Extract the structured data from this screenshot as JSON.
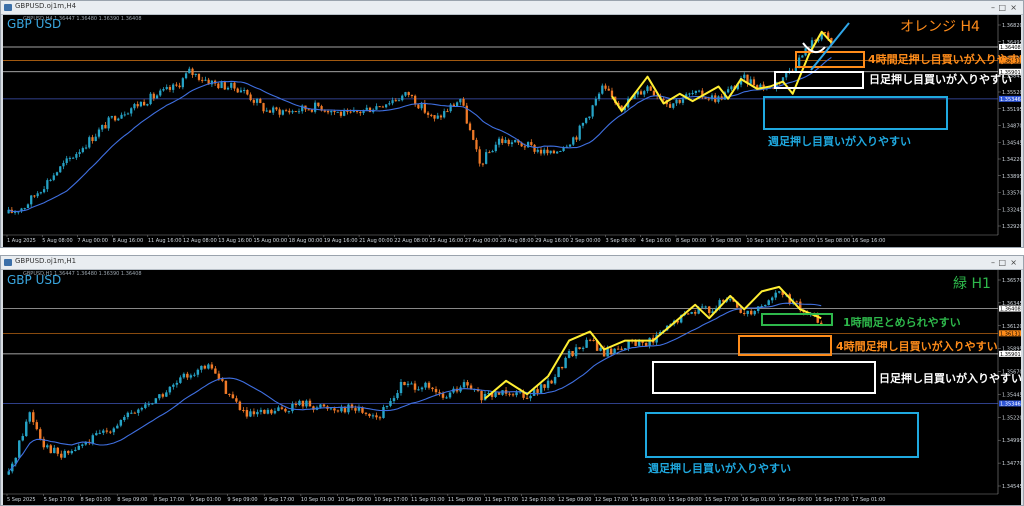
{
  "colors": {
    "bg": "#000000",
    "up": "#26a3c6",
    "down": "#f07a28",
    "ma": "#3f6fe0",
    "zigzag": "#ffee33",
    "orange": "#ff8c1a",
    "white": "#ffffff",
    "blue": "#1fa9e0",
    "green": "#2eb84b",
    "curve": "#ffffff",
    "curve_blue": "#2fa6e8"
  },
  "window_top": {
    "title": "GBPUSD.oj1m,H4",
    "ohlc": "GBPUSD,H4  1.36447 1.36480 1.36390 1.36408",
    "symbol": "GBP USD",
    "timeframe_label": "オレンジ H4",
    "price_ticks": [
      "1.36820",
      "1.36495",
      "1.36170",
      "1.35845",
      "1.35520",
      "1.35195",
      "1.34870",
      "1.34545",
      "1.34220",
      "1.33895",
      "1.33570",
      "1.33245",
      "1.32920"
    ],
    "date_ticks": [
      "1 Aug 2025",
      "5 Aug 08:00",
      "7 Aug 00:00",
      "8 Aug 16:00",
      "11 Aug 16:00",
      "12 Aug 08:00",
      "13 Aug 16:00",
      "15 Aug 00:00",
      "18 Aug 00:00",
      "19 Aug 16:00",
      "21 Aug 00:00",
      "22 Aug 08:00",
      "25 Aug 16:00",
      "27 Aug 00:00",
      "28 Aug 08:00",
      "29 Aug 16:00",
      "2 Sep 00:00",
      "3 Sep 08:00",
      "4 Sep 16:00",
      "8 Sep 00:00",
      "9 Sep 08:00",
      "10 Sep 16:00",
      "12 Sep 00:00",
      "15 Sep 08:00",
      "16 Sep 16:00"
    ],
    "level_labels": [
      "1.36408",
      "1.36131",
      "1.35901",
      "1.35346"
    ],
    "annotations": {
      "h4": "4時間足押し目買いが入りやすい",
      "daily": "日足押し目買いが入りやすい",
      "weekly": "週足押し目買いが入りやすい"
    }
  },
  "window_bottom": {
    "title": "GBPUSD.oj1m,H1",
    "ohlc": "GBPUSD,H1  1.36447 1.36480 1.36390 1.36408",
    "symbol": "GBP USD",
    "timeframe_label": "緑 H1",
    "price_ticks": [
      "1.36570",
      "1.36345",
      "1.36120",
      "1.35895",
      "1.35670",
      "1.35445",
      "1.35220",
      "1.34995",
      "1.34770",
      "1.34545"
    ],
    "date_ticks": [
      "5 Sep 2025",
      "5 Sep 17:00",
      "8 Sep 01:00",
      "8 Sep 09:00",
      "8 Sep 17:00",
      "9 Sep 01:00",
      "9 Sep 09:00",
      "9 Sep 17:00",
      "10 Sep 01:00",
      "10 Sep 09:00",
      "10 Sep 17:00",
      "11 Sep 01:00",
      "11 Sep 09:00",
      "11 Sep 17:00",
      "12 Sep 01:00",
      "12 Sep 09:00",
      "12 Sep 17:00",
      "15 Sep 01:00",
      "15 Sep 09:00",
      "15 Sep 17:00",
      "16 Sep 01:00",
      "16 Sep 09:00",
      "16 Sep 17:00",
      "17 Sep 01:00"
    ],
    "level_labels": [
      "1.36408",
      "1.36131",
      "1.35901",
      "1.35346"
    ],
    "annotations": {
      "h1": "1時間足とめられやすい",
      "h4": "4時間足押し目買いが入りやすい",
      "daily": "日足押し目買いが入りやすい",
      "weekly": "週足押し目買いが入りやすい"
    }
  },
  "chart_data": [
    {
      "type": "candlestick",
      "title": "GBPUSD.oj1m,H4",
      "ylim": [
        1.327,
        1.369
      ],
      "levels": [
        1.36408,
        1.36131,
        1.35901,
        1.35346
      ],
      "x_range": [
        "1 Aug 2025",
        "17 Sep 2025"
      ],
      "anchors": [
        [
          0,
          1.33
        ],
        [
          5,
          1.3315
        ],
        [
          14,
          1.338
        ],
        [
          25,
          1.345
        ],
        [
          33,
          1.35
        ],
        [
          42,
          1.353
        ],
        [
          52,
          1.356
        ],
        [
          56,
          1.359
        ],
        [
          64,
          1.3565
        ],
        [
          72,
          1.3555
        ],
        [
          80,
          1.351
        ],
        [
          88,
          1.351
        ],
        [
          96,
          1.352
        ],
        [
          105,
          1.35
        ],
        [
          114,
          1.352
        ],
        [
          124,
          1.3545
        ],
        [
          132,
          1.349
        ],
        [
          140,
          1.3535
        ],
        [
          146,
          1.34
        ],
        [
          152,
          1.345
        ],
        [
          160,
          1.344
        ],
        [
          168,
          1.342
        ],
        [
          176,
          1.346
        ],
        [
          184,
          1.3555
        ],
        [
          190,
          1.352
        ],
        [
          198,
          1.356
        ],
        [
          205,
          1.3525
        ],
        [
          212,
          1.3545
        ],
        [
          220,
          1.3535
        ],
        [
          228,
          1.3575
        ],
        [
          236,
          1.3555
        ],
        [
          243,
          1.36
        ],
        [
          248,
          1.364
        ],
        [
          252,
          1.3672
        ],
        [
          255,
          1.3645
        ]
      ],
      "zigzag": [
        [
          187,
          1.354
        ],
        [
          190,
          1.351
        ],
        [
          198,
          1.358
        ],
        [
          203,
          1.3525
        ],
        [
          208,
          1.3545
        ],
        [
          212,
          1.353
        ],
        [
          220,
          1.356
        ],
        [
          223,
          1.3535
        ],
        [
          227,
          1.3575
        ],
        [
          232,
          1.3555
        ],
        [
          236,
          1.356
        ],
        [
          240,
          1.357
        ],
        [
          243,
          1.3545
        ],
        [
          248,
          1.3625
        ],
        [
          252,
          1.3672
        ],
        [
          255,
          1.365
        ]
      ]
    },
    {
      "type": "candlestick",
      "title": "GBPUSD.oj1m,H1",
      "ylim": [
        1.344,
        1.3675
      ],
      "levels": [
        1.36408,
        1.36131,
        1.35901,
        1.35346
      ],
      "x_range": [
        "5 Sep 2025",
        "17 Sep 2025"
      ],
      "anchors": [
        [
          0,
          1.3455
        ],
        [
          6,
          1.3525
        ],
        [
          10,
          1.349
        ],
        [
          15,
          1.3475
        ],
        [
          22,
          1.349
        ],
        [
          30,
          1.351
        ],
        [
          38,
          1.353
        ],
        [
          46,
          1.355
        ],
        [
          52,
          1.357
        ],
        [
          58,
          1.3575
        ],
        [
          62,
          1.355
        ],
        [
          68,
          1.352
        ],
        [
          76,
          1.3525
        ],
        [
          84,
          1.3535
        ],
        [
          90,
          1.353
        ],
        [
          98,
          1.353
        ],
        [
          106,
          1.352
        ],
        [
          112,
          1.3555
        ],
        [
          118,
          1.3555
        ],
        [
          124,
          1.354
        ],
        [
          130,
          1.3555
        ],
        [
          136,
          1.354
        ],
        [
          142,
          1.355
        ],
        [
          148,
          1.3545
        ],
        [
          154,
          1.3555
        ],
        [
          160,
          1.359
        ],
        [
          166,
          1.3605
        ],
        [
          170,
          1.359
        ],
        [
          176,
          1.36
        ],
        [
          184,
          1.3605
        ],
        [
          190,
          1.3625
        ],
        [
          196,
          1.364
        ],
        [
          200,
          1.364
        ],
        [
          206,
          1.365
        ],
        [
          210,
          1.3635
        ],
        [
          215,
          1.3645
        ],
        [
          220,
          1.366
        ],
        [
          226,
          1.364
        ],
        [
          232,
          1.3625
        ]
      ],
      "zigzag": [
        [
          136,
          1.354
        ],
        [
          142,
          1.356
        ],
        [
          148,
          1.3545
        ],
        [
          154,
          1.3565
        ],
        [
          160,
          1.3605
        ],
        [
          166,
          1.3615
        ],
        [
          170,
          1.3595
        ],
        [
          176,
          1.3605
        ],
        [
          184,
          1.3605
        ],
        [
          190,
          1.3625
        ],
        [
          196,
          1.3645
        ],
        [
          200,
          1.363
        ],
        [
          206,
          1.3655
        ],
        [
          210,
          1.364
        ],
        [
          215,
          1.366
        ],
        [
          220,
          1.3665
        ],
        [
          226,
          1.364
        ],
        [
          232,
          1.363
        ]
      ]
    }
  ]
}
